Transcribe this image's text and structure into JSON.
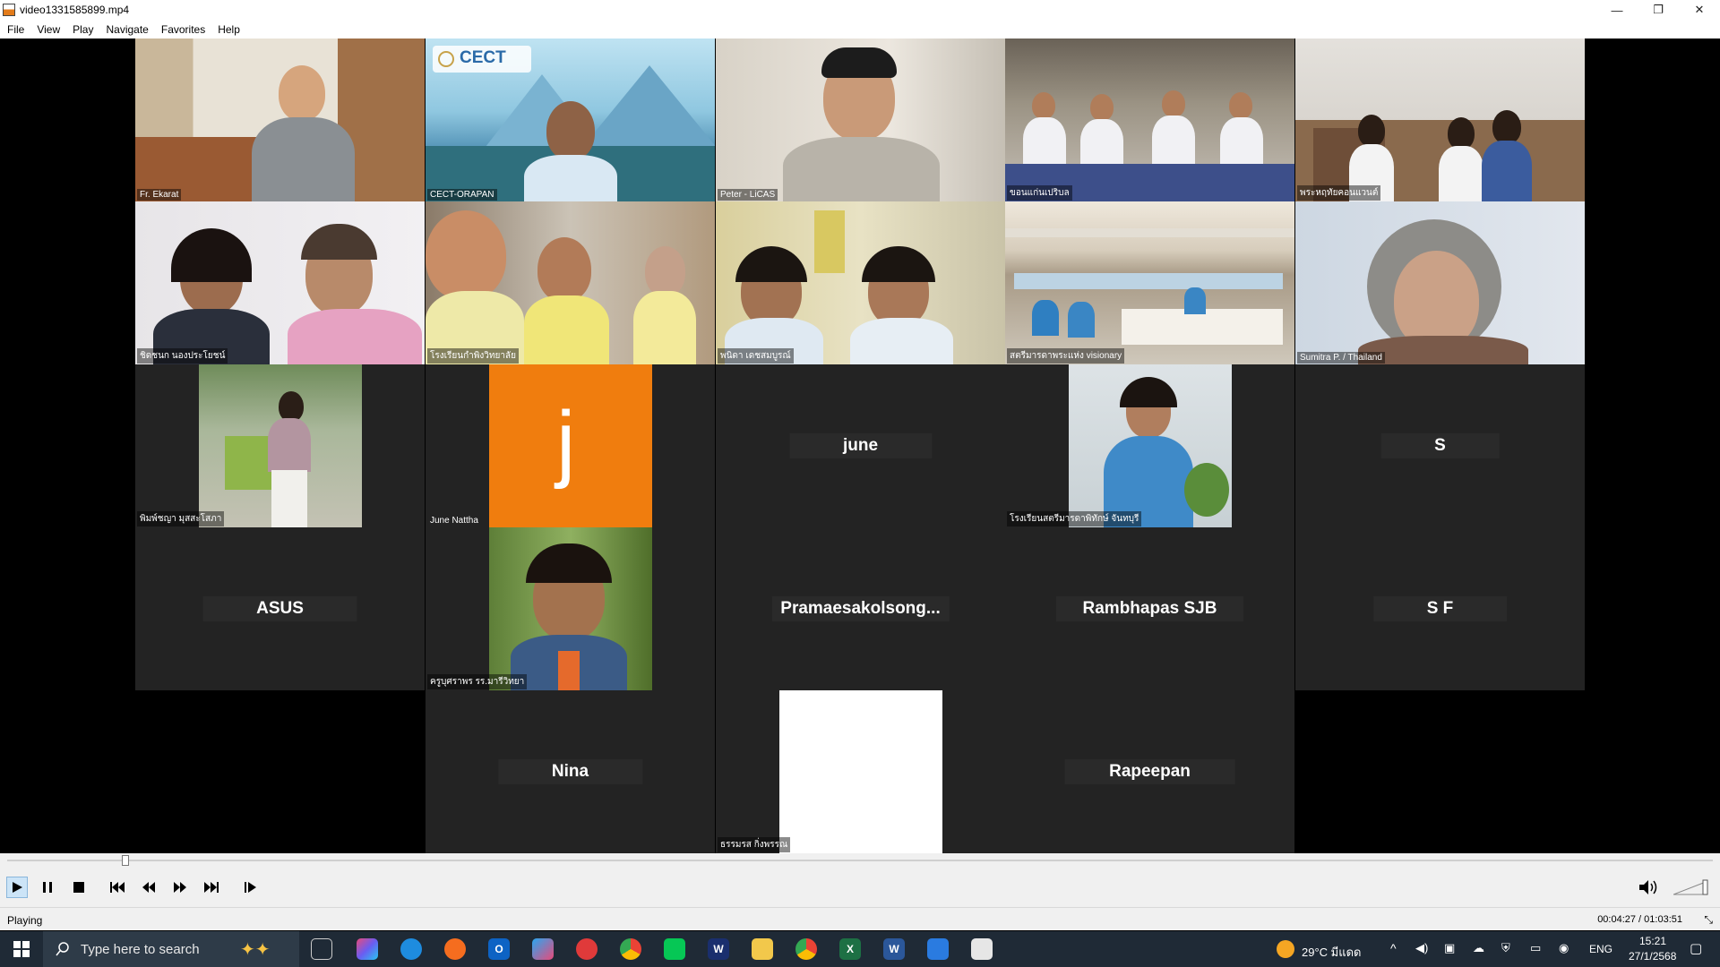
{
  "window": {
    "title": "video1331585899.mp4",
    "minimize": "—",
    "maximize": "❐",
    "close": "✕"
  },
  "menu": [
    "File",
    "View",
    "Play",
    "Navigate",
    "Favorites",
    "Help"
  ],
  "participants": {
    "r1": [
      "Fr. Ekarat",
      "CECT-ORAPAN",
      "Peter - LiCAS",
      "ขอนแก่นเปริบล",
      "พระหฤทัยคอนแวนต์"
    ],
    "r2": [
      "ชิดชนก นองประโยชน์",
      "โรงเรียนกำพิงวิทยาลัย",
      "พนิดา เดชสมบูรณ์",
      "สตรีมารดาพระแห่ง visionary",
      "Sumitra P. / Thailand"
    ],
    "r3": {
      "a": "พิมพ์ชญา มุสสะโสภา",
      "b_label": "June Nattha",
      "b_letter": "j",
      "c": "june",
      "d": "โรงเรียนสตรีมารดาพิทักษ์ จันทบุรี",
      "e": "S"
    },
    "r4": {
      "a": "ASUS",
      "b": "ครูบุศราพร รร.มารีวิทยา",
      "c": "Pramaesakolsong...",
      "d": "Rambhapas SJB",
      "e": "S F"
    },
    "r5": {
      "a": "Nina",
      "b": "ธรรมรส กิ่งพรรณ",
      "c": "Rapeepan"
    },
    "cect_logo": "CECT"
  },
  "player": {
    "status": "Playing",
    "time": "00:04:27 / 01:03:51"
  },
  "taskbar": {
    "search_placeholder": "Type here to search",
    "weather": "29°C มีแดด",
    "lang": "ENG",
    "clock": "15:21",
    "date": "27/1/2568"
  }
}
